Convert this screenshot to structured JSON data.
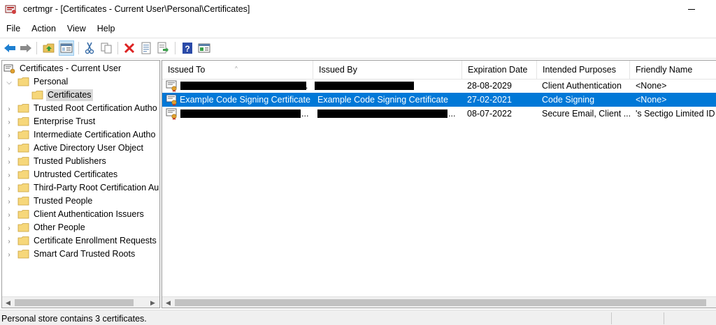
{
  "window": {
    "title": "certmgr - [Certificates - Current User\\Personal\\Certificates]",
    "app_icon": "certmgr-icon"
  },
  "menu": [
    "File",
    "Action",
    "View",
    "Help"
  ],
  "toolbar": {
    "buttons": [
      "back-arrow-icon",
      "forward-arrow-icon",
      "up-folder-icon",
      "show-hide-tree-icon",
      "cut-icon",
      "copy-icon",
      "delete-icon",
      "properties-icon",
      "export-icon",
      "help-icon",
      "console-view-icon"
    ],
    "active": "show-hide-tree-icon"
  },
  "tree": {
    "root": "Certificates - Current User",
    "items": [
      {
        "label": "Personal",
        "expanded": true
      },
      {
        "label": "Certificates",
        "selected": true
      },
      {
        "label": "Trusted Root Certification Autho"
      },
      {
        "label": "Enterprise Trust"
      },
      {
        "label": "Intermediate Certification Autho"
      },
      {
        "label": "Active Directory User Object"
      },
      {
        "label": "Trusted Publishers"
      },
      {
        "label": "Untrusted Certificates"
      },
      {
        "label": "Third-Party Root Certification Au"
      },
      {
        "label": "Trusted People"
      },
      {
        "label": "Client Authentication Issuers"
      },
      {
        "label": "Other People"
      },
      {
        "label": "Certificate Enrollment Requests"
      },
      {
        "label": "Smart Card Trusted Roots"
      }
    ]
  },
  "list": {
    "columns": [
      "Issued To",
      "Issued By",
      "Expiration Date",
      "Intended Purposes",
      "Friendly Name"
    ],
    "rows": [
      {
        "issued_to": "",
        "issued_to_suffix": "...",
        "issued_by": "",
        "expiration": "28-08-2029",
        "purposes": "Client Authentication",
        "friendly": "<None>",
        "redacted_to": true,
        "redacted_by": true
      },
      {
        "issued_to": "Example Code Signing Certificate",
        "issued_to_suffix": "",
        "issued_by": "Example Code Signing Certificate",
        "expiration": "27-02-2021",
        "purposes": "Code Signing",
        "friendly": "<None>",
        "selected": true
      },
      {
        "issued_to": "",
        "issued_to_suffix": "...",
        "issued_by": "",
        "issued_by_suffix": "...",
        "expiration": "08-07-2022",
        "purposes": "Secure Email, Client ...",
        "friendly": "'s Sectigo Limited ID",
        "redacted_to": true,
        "redacted_by": true
      }
    ]
  },
  "status": {
    "text": "Personal store contains 3 certificates."
  },
  "colors": {
    "selection": "#0078d7",
    "tree_selection": "#d9d9d9",
    "folder": "#f6d77a"
  }
}
